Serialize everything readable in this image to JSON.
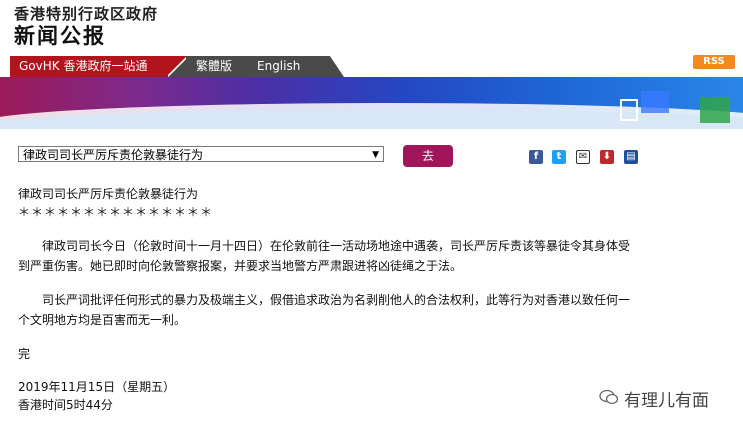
{
  "header": {
    "org_name": "香港特别行政区政府",
    "section_title": "新闻公报"
  },
  "nav": {
    "govhk_label": "GovHK 香港政府一站通",
    "traditional_label": "繁體版",
    "english_label": "English",
    "rss_label": "RSS"
  },
  "toolbar": {
    "select_value": "律政司司长严厉斥责伦敦暴徒行为",
    "go_label": "去"
  },
  "article": {
    "title": "律政司司长严厉斥责伦敦暴徒行为",
    "stars": "＊＊＊＊＊＊＊＊＊＊＊＊＊＊＊",
    "para1_line1": "　　律政司司长今日（伦敦时间十一月十四日）在伦敦前往一活动场地途中遇袭，司长严厉斥责该等暴徒令其身体受",
    "para1_line2": "到严重伤害。她已即时向伦敦警察报案，并要求当地警方严肃跟进将凶徒绳之于法。",
    "para2_line1": "　　司长严词批评任何形式的暴力及极端主义，假借追求政治为名剥削他人的合法权利，此等行为对香港以致任何一",
    "para2_line2": "个文明地方均是百害而无一利。",
    "end": "完",
    "date": "2019年11月15日（星期五）",
    "time": "香港时间5时44分"
  },
  "watermark": "有理儿有面",
  "colors": {
    "nav_red": "#b1141c",
    "go_button": "#a1165a",
    "rss": "#f48a1f"
  }
}
